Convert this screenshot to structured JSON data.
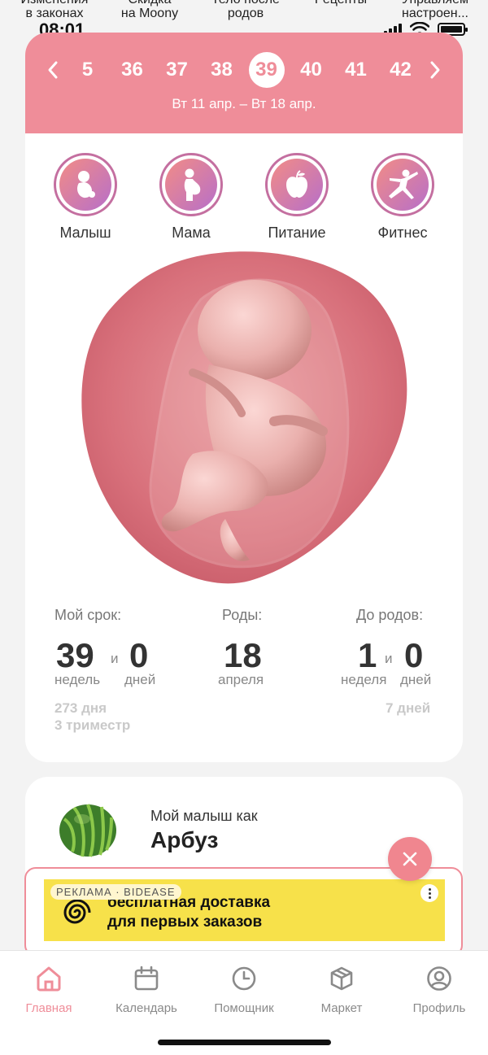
{
  "stories": [
    {
      "line1": "Изменения",
      "line2": "в законах"
    },
    {
      "line1": "Скидка",
      "line2": "на Moony"
    },
    {
      "line1": "Тело после",
      "line2": "родов"
    },
    {
      "line1": "Рецепты",
      "line2": ""
    },
    {
      "line1": "Управляем",
      "line2": "настроен..."
    }
  ],
  "status_bar": {
    "time": "08:01"
  },
  "week_selector": {
    "weeks": [
      "5",
      "36",
      "37",
      "38",
      "39",
      "40",
      "41",
      "42"
    ],
    "selected": "39",
    "date_range": "Вт 11 апр. – Вт 18 апр."
  },
  "categories": [
    {
      "label": "Малыш",
      "icon": "baby-icon"
    },
    {
      "label": "Мама",
      "icon": "pregnant-mom-icon"
    },
    {
      "label": "Питание",
      "icon": "apple-icon"
    },
    {
      "label": "Фитнес",
      "icon": "fitness-icon"
    }
  ],
  "stats": {
    "my_term": {
      "title": "Мой срок:",
      "weeks": "39",
      "and": "и",
      "days": "0",
      "weeks_unit": "недель",
      "days_unit": "дней",
      "total_days": "273 дня",
      "trimester": "3 триместр"
    },
    "birth": {
      "title": "Роды:",
      "day": "18",
      "month": "апреля"
    },
    "until_birth": {
      "title": "До родов:",
      "weeks": "1",
      "and": "и",
      "days": "0",
      "weeks_unit": "неделя",
      "days_unit": "дней",
      "total_days": "7 дней"
    }
  },
  "baby_size": {
    "pre": "Мой малыш как",
    "fruit": "Арбуз",
    "icon": "watermelon-icon"
  },
  "ad": {
    "tag": "РЕКЛАМА · BIDEASE",
    "line1": "бесплатная доставка",
    "line2": "для первых заказов"
  },
  "tabbar": [
    {
      "label": "Главная",
      "icon": "home-icon",
      "active": true
    },
    {
      "label": "Календарь",
      "icon": "calendar-icon",
      "active": false
    },
    {
      "label": "Помощник",
      "icon": "clock-icon",
      "active": false
    },
    {
      "label": "Маркет",
      "icon": "box-icon",
      "active": false
    },
    {
      "label": "Профиль",
      "icon": "profile-icon",
      "active": false
    }
  ],
  "colors": {
    "accent": "#ef8d99",
    "gradient_start": "#f28c86",
    "gradient_end": "#b76fc9",
    "ad_yellow": "#f7e14a"
  }
}
